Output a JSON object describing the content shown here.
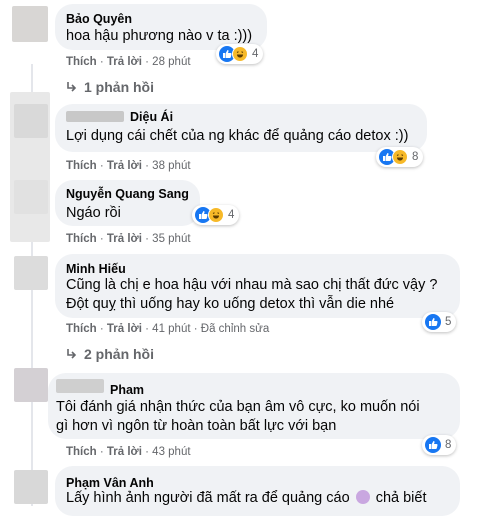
{
  "comments": [
    {
      "name": "Bảo Quyên",
      "text": "hoa hậu phương nào v ta :)))",
      "like": "Thích",
      "reply": "Trả lời",
      "time": "28 phút",
      "reactions": "4"
    },
    {
      "name": "Diệu Ái",
      "text": "Lợi dụng cái chết của ng khác để quảng cáo detox :))",
      "like": "Thích",
      "reply": "Trả lời",
      "time": "38 phút",
      "reactions": "8"
    },
    {
      "name": "Nguyễn Quang Sang",
      "text": "Ngáo rồi",
      "like": "Thích",
      "reply": "Trả lời",
      "time": "35 phút",
      "reactions": "4"
    },
    {
      "name": "Minh Hiếu",
      "text1": "Cũng là chị e hoa hậu với nhau mà sao chị thất đức vậy ?",
      "text2": "Đột quỵ thì uống hay ko uống detox thì vẫn die nhé",
      "like": "Thích",
      "reply": "Trả lời",
      "time": "41 phút",
      "edited": "Đã chỉnh sửa",
      "reactions": "5"
    },
    {
      "name": "Pham",
      "text1": "Tôi đánh giá nhận thức của bạn âm vô cực, ko muốn nói",
      "text2": "gì hơn vì ngôn từ hoàn toàn bất lực với bạn",
      "like": "Thích",
      "reply": "Trả lời",
      "time": "43 phút",
      "reactions": "8"
    },
    {
      "name": "Phạm Vân Anh",
      "text_a": "Lấy hình ảnh người đã mất ra để quảng cáo",
      "text_b": "chả biết"
    }
  ],
  "replies": [
    {
      "label": "1 phản hồi"
    },
    {
      "label": "2 phản hồi"
    }
  ],
  "separator": "·",
  "icons": {
    "like": "thumbs-up-icon",
    "haha": "laughing-face-icon",
    "reply_arrow": "reply-arrow-icon",
    "emoji": "girl-shrug-emoji"
  },
  "colors": {
    "bubble": "#f0f2f5",
    "meta": "#65676b",
    "like_blue": "#1877f2",
    "haha_yellow": "#f7b928"
  }
}
